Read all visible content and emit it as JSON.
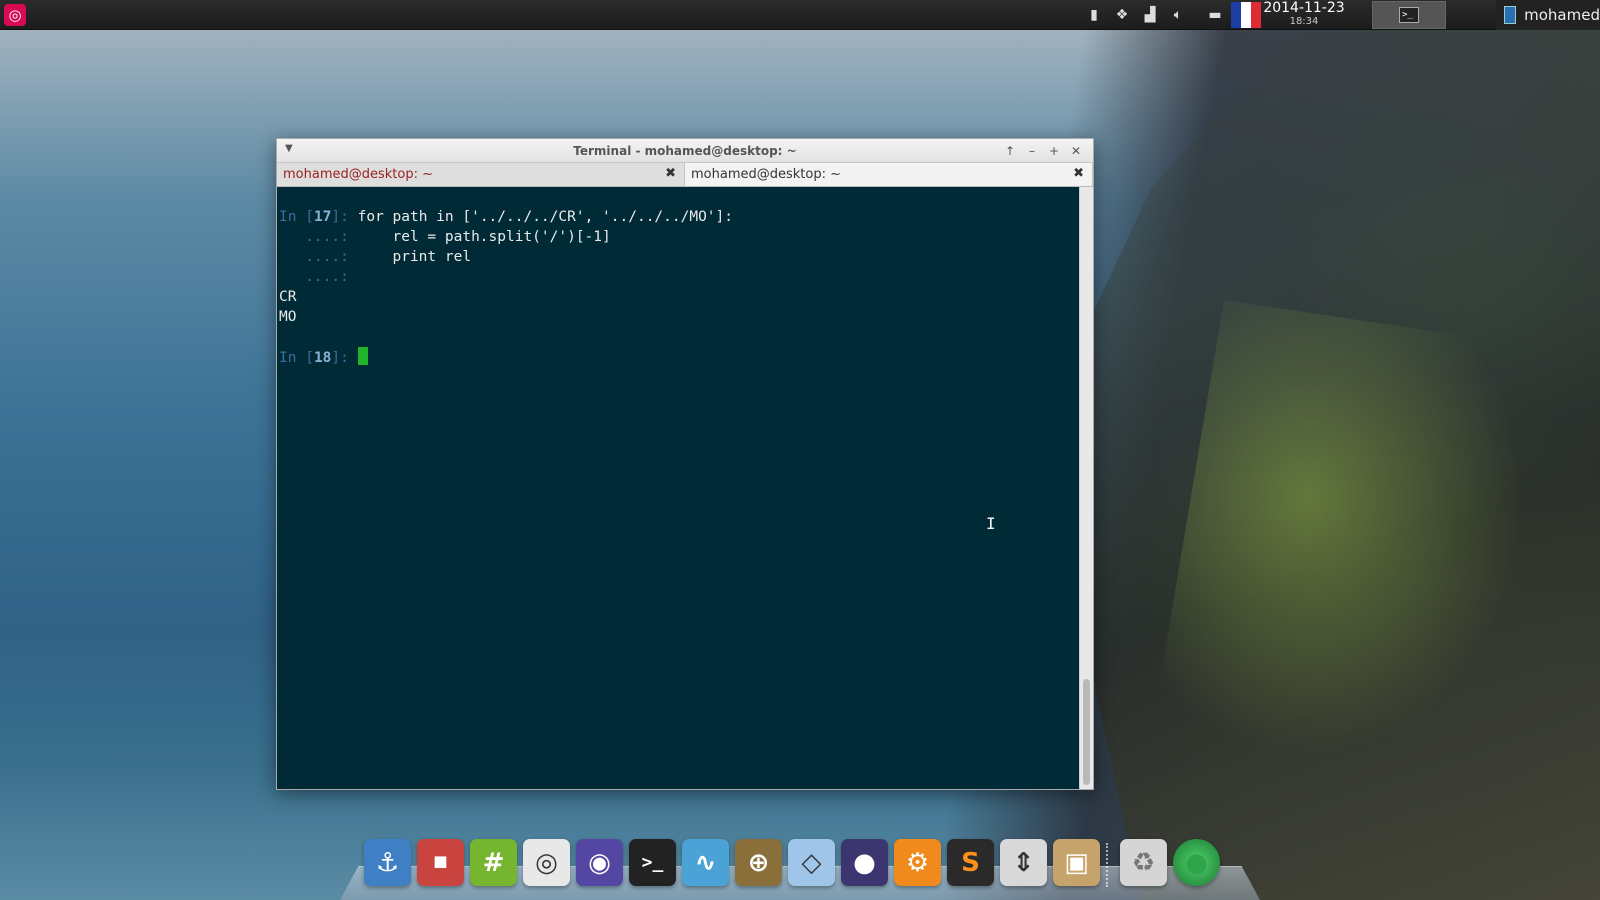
{
  "top_panel": {
    "clock": {
      "date": "2014-11-23",
      "time": "18:34"
    },
    "user": {
      "name": "mohamed"
    },
    "task_button_glyph": ">_"
  },
  "window": {
    "title": "Terminal - mohamed@desktop: ~",
    "tabs": [
      {
        "label": "mohamed@desktop: ~",
        "active": true
      },
      {
        "label": "mohamed@desktop: ~",
        "active": false
      }
    ]
  },
  "terminal": {
    "in_label": "In ",
    "cont_prompt": "   ....: ",
    "block1": {
      "num": "17",
      "code": "for path in ['../../../CR', '../../../MO']:",
      "cont_lines": [
        "    rel = path.split('/')[-1]",
        "    print rel",
        ""
      ],
      "outputs": [
        "CR",
        "MO"
      ]
    },
    "block2": {
      "num": "18"
    }
  },
  "dock": {
    "items": [
      {
        "name": "anchor",
        "glyph": "⚓",
        "color": "#3f7fc4"
      },
      {
        "name": "stop-sign-app",
        "glyph": "⏹",
        "color": "#c9443e"
      },
      {
        "name": "hexchat",
        "glyph": "#",
        "color": "#75b52f"
      },
      {
        "name": "chrome",
        "glyph": "◎",
        "color": "#e8e8e8"
      },
      {
        "name": "empathy",
        "glyph": "◉",
        "color": "#5347a3"
      },
      {
        "name": "terminal",
        "glyph": ">_",
        "color": "#222222"
      },
      {
        "name": "system-monitor",
        "glyph": "∿",
        "color": "#4aa2d6"
      },
      {
        "name": "crosshair",
        "glyph": "⊕",
        "color": "#8a6f3a"
      },
      {
        "name": "cube",
        "glyph": "◇",
        "color": "#9fc6e8"
      },
      {
        "name": "eclipse",
        "glyph": "●",
        "color": "#3b3670"
      },
      {
        "name": "settings",
        "glyph": "⚙",
        "color": "#f08a1c"
      },
      {
        "name": "sublime-text",
        "glyph": "S",
        "color": "#2a2a2a"
      },
      {
        "name": "transfer",
        "glyph": "⇕",
        "color": "#d8d8d8"
      },
      {
        "name": "package-installer",
        "glyph": "▣",
        "color": "#c6a36b"
      }
    ],
    "trash": {
      "glyph": "♻",
      "color": "#aaaaaa"
    },
    "globe": {
      "glyph": "●",
      "color": "#2fa44a"
    }
  }
}
